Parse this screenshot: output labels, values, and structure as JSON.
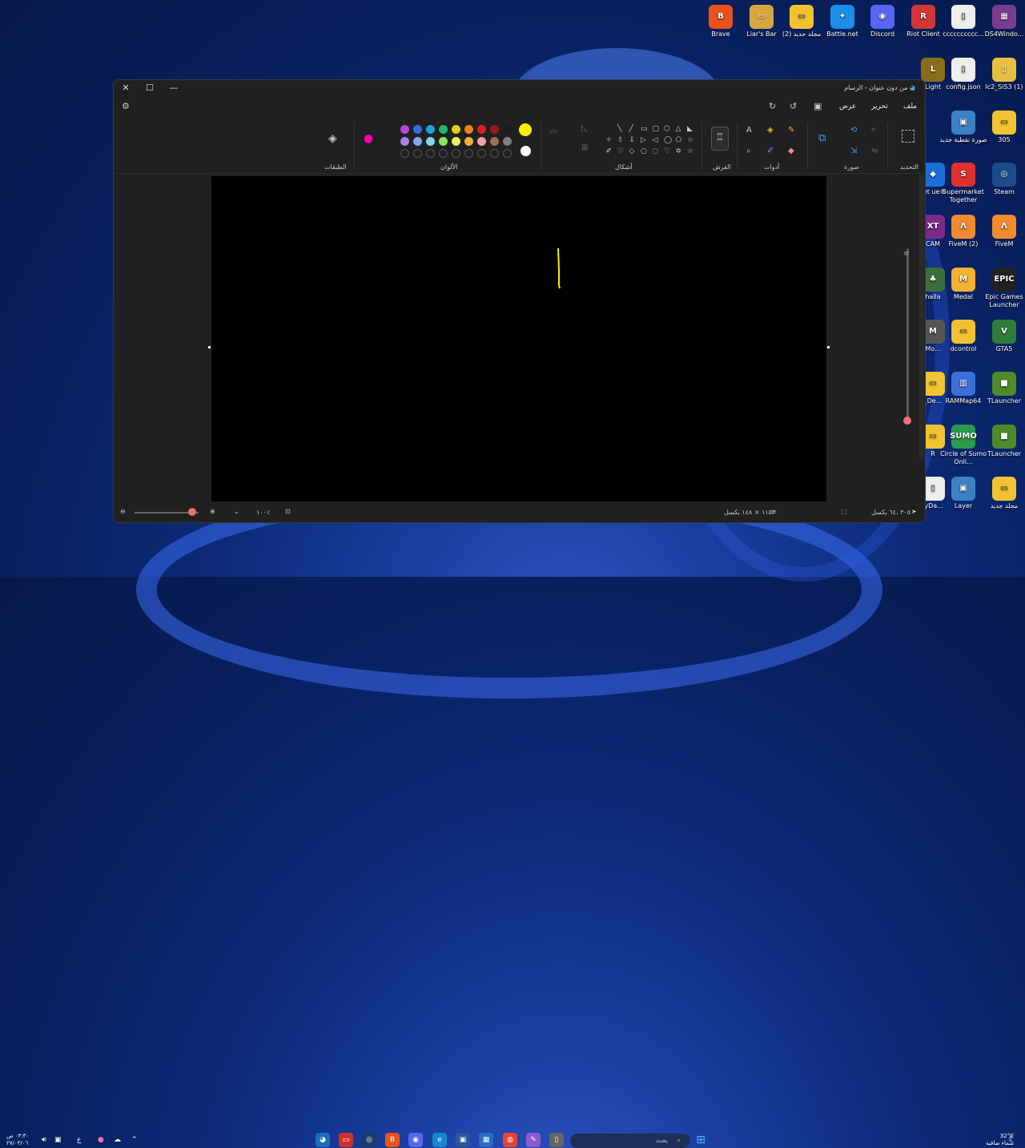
{
  "desktop": {
    "icons": [
      {
        "label": "Brave",
        "color": "#e8521a",
        "glyph": "B"
      },
      {
        "label": "Liar's Bar",
        "color": "#d8a640",
        "glyph": "▭"
      },
      {
        "label": "مجلد جديد (2)",
        "color": "#f1c232",
        "glyph": "▭"
      },
      {
        "label": "Battle.net",
        "color": "#1c8ee8",
        "glyph": "✦"
      },
      {
        "label": "Discord",
        "color": "#5865f2",
        "glyph": "◉"
      },
      {
        "label": "Riot Client",
        "color": "#d13639",
        "glyph": "R"
      },
      {
        "label": "cccccccccc...",
        "color": "#eeeeee",
        "glyph": "▯"
      },
      {
        "label": "DS4Windo...",
        "color": "#7a3c8c",
        "glyph": "▦"
      },
      {
        "label": "Light",
        "color": "#8a6d1a",
        "glyph": "L"
      },
      {
        "label": "config.json",
        "color": "#eeeeee",
        "glyph": "▯"
      },
      {
        "label": "lc2_SiS3 (1)",
        "color": "#e8c040",
        "glyph": "▯"
      },
      {
        "label": "صورة نقطية جديد",
        "color": "#3b82c4",
        "glyph": "▣"
      },
      {
        "label": "305",
        "color": "#f1c232",
        "glyph": "▭"
      },
      {
        "label": "Supermarket Together",
        "color": "#e03030",
        "glyph": "S"
      },
      {
        "label": "Steam",
        "color": "#1b4c8a",
        "glyph": "◎"
      },
      {
        "label": "CAM",
        "color": "#7a2b8a",
        "glyph": "XT"
      },
      {
        "label": "FiveM (2)",
        "color": "#f28b30",
        "glyph": "Λ"
      },
      {
        "label": "FiveM",
        "color": "#f28b30",
        "glyph": "Λ"
      },
      {
        "label": "halla",
        "color": "#3c6e3c",
        "glyph": "♣"
      },
      {
        "label": "Medal",
        "color": "#f2b233",
        "glyph": "M"
      },
      {
        "label": "Epic Games Launcher",
        "color": "#222222",
        "glyph": "EPIC"
      },
      {
        "label": "Mo...",
        "color": "#555555",
        "glyph": "M"
      },
      {
        "label": "dcontrol",
        "color": "#f1c232",
        "glyph": "▭"
      },
      {
        "label": "GTA5",
        "color": "#2f7d3a",
        "glyph": "V"
      },
      {
        "label": "_De...",
        "color": "#f1c232",
        "glyph": "▭"
      },
      {
        "label": "RAMMap64",
        "color": "#3d6fd8",
        "glyph": "▥"
      },
      {
        "label": "TLauncher",
        "color": "#4c8a2c",
        "glyph": "■"
      },
      {
        "label": "R",
        "color": "#f1c232",
        "glyph": "▭"
      },
      {
        "label": "Circle of Sumo Onli...",
        "color": "#2a9a4c",
        "glyph": "SUMO"
      },
      {
        "label": "TLauncher",
        "color": "#4c8a2c",
        "glyph": "■"
      },
      {
        "label": "lyDa...",
        "color": "#eeeeee",
        "glyph": "▯"
      },
      {
        "label": "Layer",
        "color": "#3b82c4",
        "glyph": "▣"
      },
      {
        "label": "مجلد جديد",
        "color": "#f1c232",
        "glyph": "▭"
      },
      {
        "label": "ket ue®",
        "color": "#1c6fd8",
        "glyph": "◆"
      }
    ]
  },
  "window": {
    "title": "من دون عنوان - الرسام",
    "buttons": {
      "close": "✕",
      "maximize": "☐",
      "minimize": "—"
    },
    "menu": {
      "file": "ملف",
      "edit": "تحرير",
      "view": "عرض"
    },
    "ribbon": {
      "groups": {
        "select": "التحديد",
        "image": "صورة",
        "tools": "أدوات",
        "brushes": "الفرش",
        "shapes": "أشكال",
        "colors": "الألوان",
        "layers": "الطبقات"
      },
      "palette_row1": [
        "#b04ad0",
        "#3a6ae0",
        "#1ea0e0",
        "#1db870",
        "#e0d020",
        "#f08020",
        "#e02020",
        "#a01818",
        "#1a1a1a"
      ],
      "palette_row2": [
        "#a880e8",
        "#80a8f0",
        "#80d8f0",
        "#90e060",
        "#f0f060",
        "#f0b040",
        "#f0a0b0",
        "#a07050",
        "#808080"
      ],
      "current_primary": "#ffee00",
      "current_secondary": "#ffffff"
    },
    "status": {
      "position": "٣٠٥ ،٦٤ بكسل",
      "canvas_size": "١١٥٣ × ١٤٨ بكسل",
      "zoom": "١٠٠٪"
    }
  },
  "taskbar": {
    "search_placeholder": "بحث",
    "time": "٠٣:٣٠ ص",
    "date": "٢٧/٠٣/٠٦",
    "weather_temp": "32°C",
    "weather_desc": "سماء صافية",
    "lang": "ع"
  }
}
